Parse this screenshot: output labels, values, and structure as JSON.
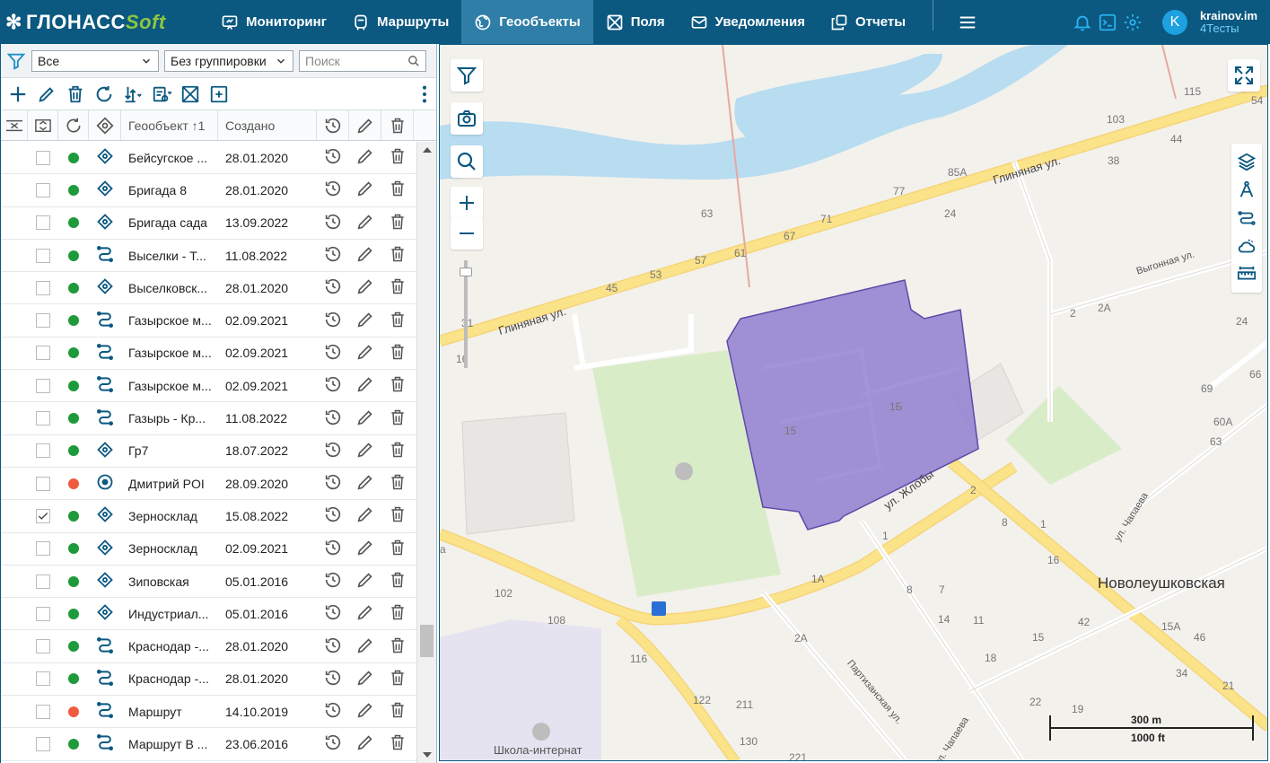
{
  "brand": {
    "name_main": "ГЛОНАСС",
    "name_accent": "Soft"
  },
  "nav": [
    {
      "label": "Мониторинг",
      "icon": "monitoring-icon"
    },
    {
      "label": "Маршруты",
      "icon": "routes-icon"
    },
    {
      "label": "Геообъекты",
      "icon": "globe-icon",
      "active": true
    },
    {
      "label": "Поля",
      "icon": "fields-icon"
    },
    {
      "label": "Уведомления",
      "icon": "mail-icon"
    },
    {
      "label": "Отчеты",
      "icon": "reports-icon"
    }
  ],
  "user": {
    "initial": "K",
    "name": "krainov.im",
    "account": "4Тесты"
  },
  "filter": {
    "type_value": "Все",
    "grouping_value": "Без группировки",
    "search_placeholder": "Поиск"
  },
  "table": {
    "col_geo": "Геообъект ↑1",
    "col_created": "Создано",
    "rows": [
      {
        "name": "Бейсугское ...",
        "date": "28.01.2020",
        "status": "green",
        "kind": "polygon",
        "checked": false
      },
      {
        "name": "Бригада 8",
        "date": "28.01.2020",
        "status": "green",
        "kind": "polygon",
        "checked": false
      },
      {
        "name": "Бригада сада",
        "date": "13.09.2022",
        "status": "green",
        "kind": "polygon",
        "checked": false
      },
      {
        "name": "Выселки - Т...",
        "date": "11.08.2022",
        "status": "green",
        "kind": "line",
        "checked": false
      },
      {
        "name": "Выселковск...",
        "date": "28.01.2020",
        "status": "green",
        "kind": "polygon",
        "checked": false
      },
      {
        "name": "Газырское м...",
        "date": "02.09.2021",
        "status": "green",
        "kind": "line",
        "checked": false
      },
      {
        "name": "Газырское м...",
        "date": "02.09.2021",
        "status": "green",
        "kind": "line",
        "checked": false
      },
      {
        "name": "Газырское м...",
        "date": "02.09.2021",
        "status": "green",
        "kind": "line",
        "checked": false
      },
      {
        "name": "Газырь - Кр...",
        "date": "11.08.2022",
        "status": "green",
        "kind": "line",
        "checked": false
      },
      {
        "name": "Гр7",
        "date": "18.07.2022",
        "status": "green",
        "kind": "polygon",
        "checked": false
      },
      {
        "name": "Дмитрий POI",
        "date": "28.09.2020",
        "status": "red",
        "kind": "poi",
        "checked": false
      },
      {
        "name": "Зерносклад",
        "date": "15.08.2022",
        "status": "green",
        "kind": "polygon",
        "checked": true
      },
      {
        "name": "Зерносклад",
        "date": "02.09.2021",
        "status": "green",
        "kind": "polygon",
        "checked": false
      },
      {
        "name": "Зиповская",
        "date": "05.01.2016",
        "status": "green",
        "kind": "polygon",
        "checked": false
      },
      {
        "name": "Индустриал...",
        "date": "05.01.2016",
        "status": "green",
        "kind": "polygon",
        "checked": false
      },
      {
        "name": "Краснодар -...",
        "date": "28.01.2020",
        "status": "green",
        "kind": "line",
        "checked": false
      },
      {
        "name": "Краснодар -...",
        "date": "28.01.2020",
        "status": "green",
        "kind": "line",
        "checked": false
      },
      {
        "name": "Маршрут",
        "date": "14.10.2019",
        "status": "red",
        "kind": "line",
        "checked": false
      },
      {
        "name": "Маршрут В ...",
        "date": "23.06.2016",
        "status": "green",
        "kind": "line",
        "checked": false
      }
    ]
  },
  "map": {
    "labels": {
      "street1": "Глиняная ул.",
      "street2": "Глиняная ул.",
      "street3": "ул. Жлобы",
      "street4": "Выгонная ул.",
      "street5": "ул. Чапаева",
      "street6": "Партизанская ул.",
      "street7": "ул. Чапаева",
      "district": "Новолеушковская",
      "school": "Школа-интернат"
    },
    "house_numbers": [
      "115",
      "103",
      "44",
      "54",
      "38",
      "85А",
      "77",
      "24",
      "63",
      "71",
      "67",
      "61",
      "57",
      "53",
      "45",
      "31",
      "16",
      "15",
      "1Б",
      "2",
      "2А",
      "66",
      "69",
      "60А",
      "63",
      "2",
      "8",
      "1",
      "16",
      "1",
      "1А",
      "8",
      "7",
      "14",
      "11",
      "15",
      "42",
      "15А",
      "46",
      "34",
      "21",
      "102",
      "108",
      "116",
      "2А",
      "18",
      "22",
      "19",
      "122",
      "211",
      "130",
      "221",
      "24",
      "а"
    ],
    "scale_metric": "300 m",
    "scale_imperial": "1000 ft",
    "colors": {
      "polygon_fill": "#8f7fd1",
      "polygon_stroke": "#5b4aa8",
      "road": "#fbe38a",
      "water": "#b8dcf0",
      "park": "#d9ecc8"
    }
  },
  "colors": {
    "brand": "#0b5880",
    "active_tab": "#2f7ea8",
    "accent_green": "#8dc63f",
    "status_green": "#1e9a3a",
    "status_red": "#f05a3f"
  }
}
